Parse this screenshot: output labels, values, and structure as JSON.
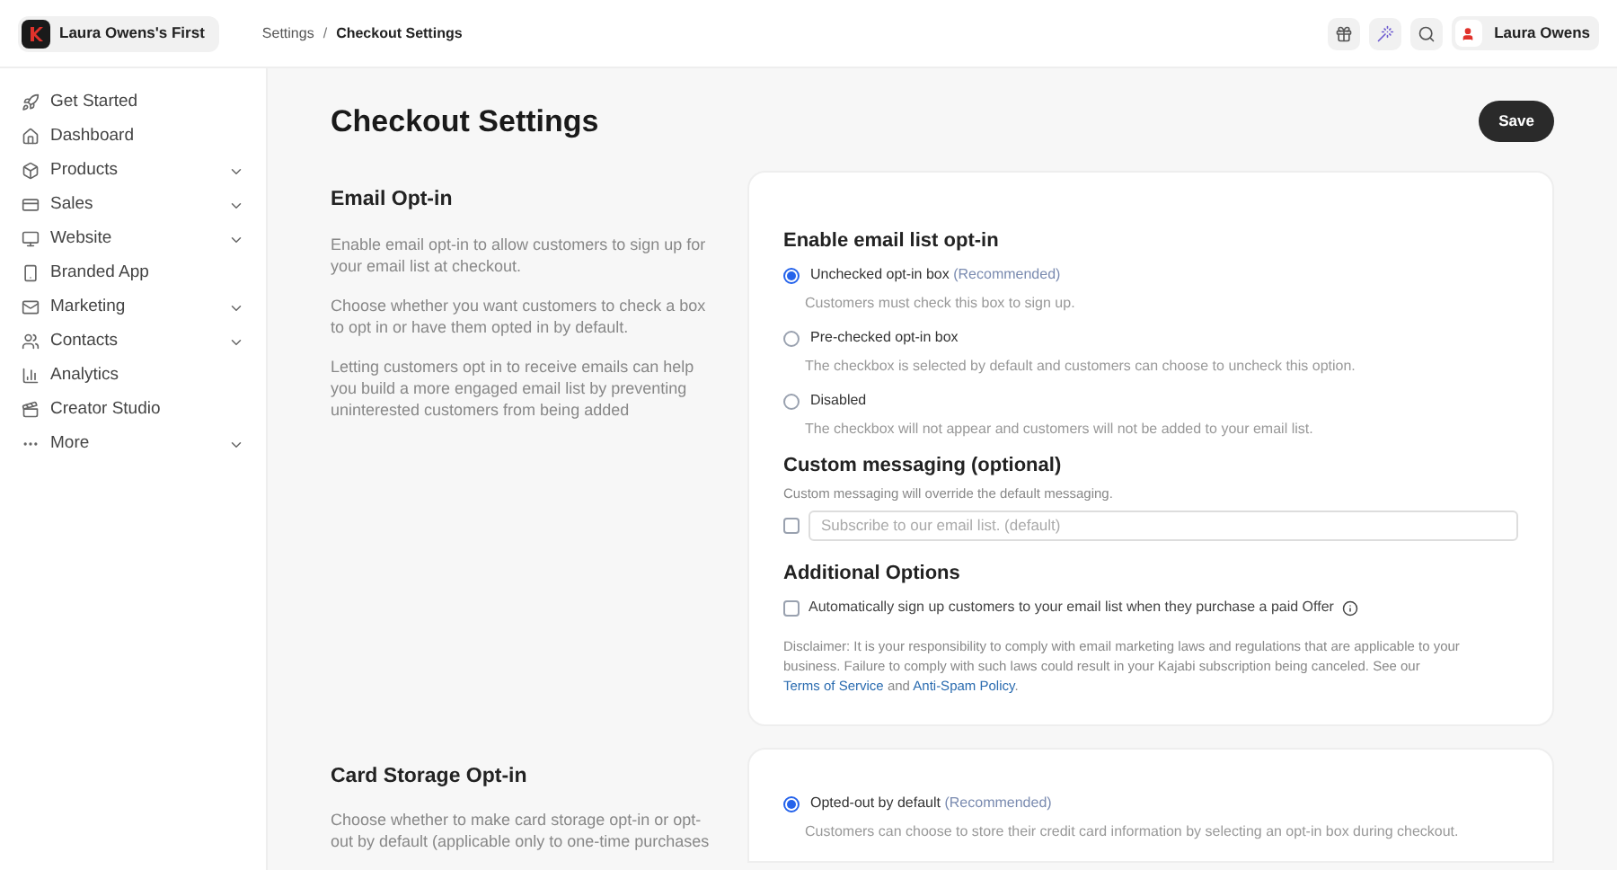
{
  "brand": {
    "name": "Laura Owens's First"
  },
  "breadcrumb": [
    "Settings",
    "Checkout Settings"
  ],
  "breadcrumb_separator": "/",
  "user": {
    "name": "Laura Owens"
  },
  "sidebar": {
    "items": [
      {
        "label": "Get Started",
        "has_submenu": false
      },
      {
        "label": "Dashboard",
        "has_submenu": false
      },
      {
        "label": "Products",
        "has_submenu": true
      },
      {
        "label": "Sales",
        "has_submenu": true
      },
      {
        "label": "Website",
        "has_submenu": true
      },
      {
        "label": "Branded App",
        "has_submenu": false
      },
      {
        "label": "Marketing",
        "has_submenu": true
      },
      {
        "label": "Contacts",
        "has_submenu": true
      },
      {
        "label": "Analytics",
        "has_submenu": false
      },
      {
        "label": "Creator Studio",
        "has_submenu": false
      },
      {
        "label": "More",
        "has_submenu": true
      }
    ]
  },
  "page": {
    "title": "Checkout Settings",
    "save_button": "Save"
  },
  "sections": [
    {
      "title": "Email Opt-in",
      "paragraphs": [
        "Enable email opt-in to allow customers to sign up for your email list at checkout.",
        "Choose whether you want customers to check a box to opt in or have them opted in by default.",
        "Letting customers opt in to receive emails can help you build a more engaged email list by preventing uninterested customers from being added"
      ],
      "card": {
        "heading": "Enable email list opt-in",
        "options": [
          {
            "label": "Unchecked opt-in box",
            "note": "(Recommended)",
            "description": "Customers must check this box to sign up.",
            "selected": true
          },
          {
            "label": "Pre-checked opt-in box",
            "description": "The checkbox is selected by default and customers can choose to uncheck this option.",
            "selected": false
          },
          {
            "label": "Disabled",
            "description": "The checkbox will not appear and customers will not be added to your email list.",
            "selected": false
          }
        ],
        "custom_messaging": {
          "heading": "Custom messaging (optional)",
          "subtitle": "Custom messaging will override the default messaging.",
          "checked": false,
          "placeholder": "Subscribe to our email list. (default)"
        },
        "additional": {
          "heading": "Additional Options",
          "checkbox_label": "Automatically sign up customers to your email list when they purchase a paid Offer",
          "checked": false,
          "disclaimer": [
            {
              "kind": "text",
              "text": "Disclaimer: It is your responsibility to comply with email marketing laws and regulations that are applicable to your business. Failure to comply with such laws could result in your Kajabi subscription being canceled. See our "
            },
            {
              "kind": "link",
              "text": "Terms of Service"
            },
            {
              "kind": "text",
              "text": " and "
            },
            {
              "kind": "link",
              "text": "Anti-Spam Policy"
            },
            {
              "kind": "text",
              "text": "."
            }
          ]
        }
      }
    },
    {
      "title": "Card Storage Opt-in",
      "paragraphs": [
        "Choose whether to make card storage opt-in or opt-out by default (applicable only to one-time purchases"
      ],
      "card": {
        "options": [
          {
            "label": "Opted-out by default",
            "note": "(Recommended)",
            "description": "Customers can choose to store their credit card information by selecting an opt-in box during checkout.",
            "selected": true
          }
        ]
      }
    }
  ]
}
